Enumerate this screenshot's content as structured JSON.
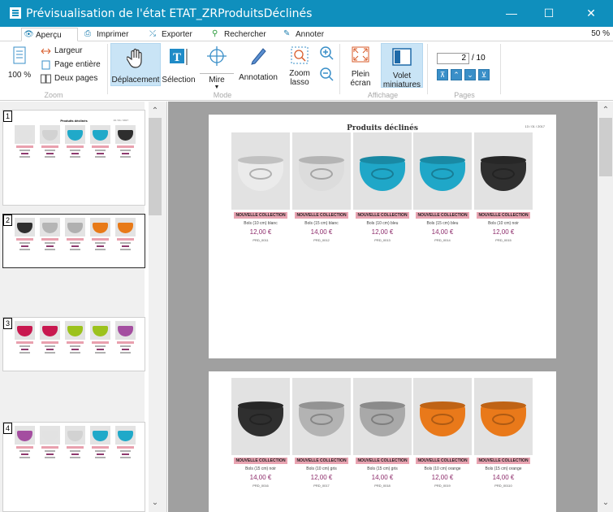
{
  "window": {
    "title": "Prévisualisation de l'état ETAT_ZRProduitsDéclinés"
  },
  "tabs": [
    {
      "label": "Aperçu",
      "icon": "eye-icon"
    },
    {
      "label": "Imprimer",
      "icon": "printer-icon"
    },
    {
      "label": "Exporter",
      "icon": "share-icon"
    },
    {
      "label": "Rechercher",
      "icon": "search-icon"
    },
    {
      "label": "Annoter",
      "icon": "pen-icon"
    }
  ],
  "zoom_level": "50 %",
  "ribbon": {
    "zoom": {
      "label": "Zoom",
      "percent": "100 %",
      "width": "Largeur",
      "full_page": "Page entière",
      "two_pages": "Deux pages"
    },
    "mode": {
      "label": "Mode",
      "move": "Déplacement",
      "selection": "Sélection",
      "target": "Mire",
      "annotation": "Annotation",
      "zoom_lasso_1": "Zoom",
      "zoom_lasso_2": "lasso"
    },
    "display": {
      "label": "Affichage",
      "fullscreen_1": "Plein",
      "fullscreen_2": "écran",
      "thumbs_1": "Volet",
      "thumbs_2": "miniatures"
    },
    "pages": {
      "label": "Pages",
      "current": "2",
      "total": "/ 10"
    }
  },
  "thumbnails": [
    {
      "num": "1",
      "title": "Produits déclinés",
      "date": "13 / 01 / 2017",
      "colors": [
        "#e2e2e2",
        "#d2d2d2",
        "#20a9c9",
        "#20a9c9",
        "#2e2e2e"
      ]
    },
    {
      "num": "2",
      "colors": [
        "#2e2e2e",
        "#b5b5b5",
        "#b0b0b0",
        "#e87a18",
        "#e87a18"
      ]
    },
    {
      "num": "3",
      "colors": [
        "#c8184f",
        "#c8184f",
        "#9cc21c",
        "#9cc21c",
        "#a44ea0"
      ]
    },
    {
      "num": "4",
      "colors": [
        "#a44ea0",
        "#e2e2e2",
        "#d2d2d2",
        "#20a9c9",
        "#20a9c9"
      ]
    }
  ],
  "page1": {
    "title": "Produits déclinés",
    "date": "13 / 01 / 2017",
    "products": [
      {
        "badge": "NOUVELLE COLLECTION",
        "label": "Bols (10 cm) blanc",
        "price": "12,00 €",
        "ref": "PRD_0011",
        "color": "#ebebeb"
      },
      {
        "badge": "NOUVELLE COLLECTION",
        "label": "Bols (15 cm) blanc",
        "price": "14,00 €",
        "ref": "PRD_0012",
        "color": "#dcdcdc"
      },
      {
        "badge": "NOUVELLE COLLECTION",
        "label": "Bols (10 cm) bleu",
        "price": "12,00 €",
        "ref": "PRD_0013",
        "color": "#1fa7c8"
      },
      {
        "badge": "NOUVELLE COLLECTION",
        "label": "Bols (15 cm) bleu",
        "price": "14,00 €",
        "ref": "PRD_0014",
        "color": "#1fa7c8"
      },
      {
        "badge": "NOUVELLE COLLECTION",
        "label": "Bols (10 cm) noir",
        "price": "12,00 €",
        "ref": "PRD_0015",
        "color": "#2f2f2f"
      }
    ]
  },
  "page2": {
    "products": [
      {
        "badge": "NOUVELLE COLLECTION",
        "label": "Bols (15 cm) noir",
        "price": "14,00 €",
        "ref": "PRD_0016",
        "color": "#2f2f2f"
      },
      {
        "badge": "NOUVELLE COLLECTION",
        "label": "Bols (10 cm) gris",
        "price": "12,00 €",
        "ref": "PRD_0017",
        "color": "#b3b3b3"
      },
      {
        "badge": "NOUVELLE COLLECTION",
        "label": "Bols (15 cm) gris",
        "price": "14,00 €",
        "ref": "PRD_0018",
        "color": "#a9a9a9"
      },
      {
        "badge": "NOUVELLE COLLECTION",
        "label": "Bols (10 cm) orange",
        "price": "12,00 €",
        "ref": "PRD_0019",
        "color": "#e9791a"
      },
      {
        "badge": "NOUVELLE COLLECTION",
        "label": "Bols (15 cm) orange",
        "price": "14,00 €",
        "ref": "PRD_00110",
        "color": "#e9791a"
      }
    ]
  }
}
